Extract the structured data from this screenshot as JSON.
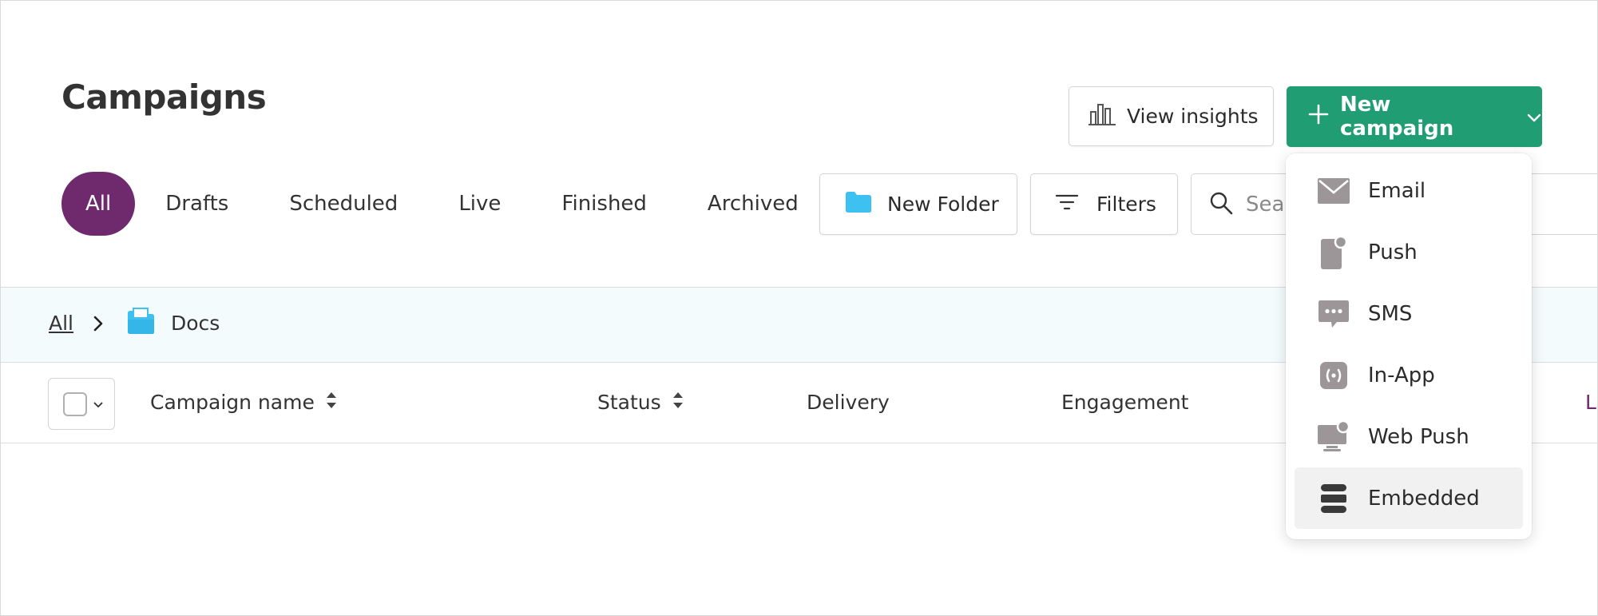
{
  "page": {
    "title": "Campaigns"
  },
  "toolbar": {
    "view_insights_label": "View insights",
    "new_campaign_label": "New campaign",
    "accent_color": "#219d74"
  },
  "tabs": [
    {
      "label": "All",
      "active": true
    },
    {
      "label": "Drafts",
      "active": false
    },
    {
      "label": "Scheduled",
      "active": false
    },
    {
      "label": "Live",
      "active": false
    },
    {
      "label": "Finished",
      "active": false
    },
    {
      "label": "Archived",
      "active": false
    }
  ],
  "actions": {
    "new_folder_label": "New Folder",
    "filters_label": "Filters",
    "search_placeholder": "Search"
  },
  "breadcrumb": {
    "root": "All",
    "current": "Docs"
  },
  "table": {
    "columns": [
      "Campaign name",
      "Status",
      "Delivery",
      "Engagement",
      "L"
    ]
  },
  "new_campaign_menu": {
    "items": [
      {
        "label": "Email",
        "icon": "envelope-icon"
      },
      {
        "label": "Push",
        "icon": "push-phone-icon"
      },
      {
        "label": "SMS",
        "icon": "chat-bubble-icon"
      },
      {
        "label": "In-App",
        "icon": "in-app-icon"
      },
      {
        "label": "Web Push",
        "icon": "monitor-notification-icon"
      },
      {
        "label": "Embedded",
        "icon": "stacked-bars-icon",
        "highlighted": true
      }
    ]
  }
}
